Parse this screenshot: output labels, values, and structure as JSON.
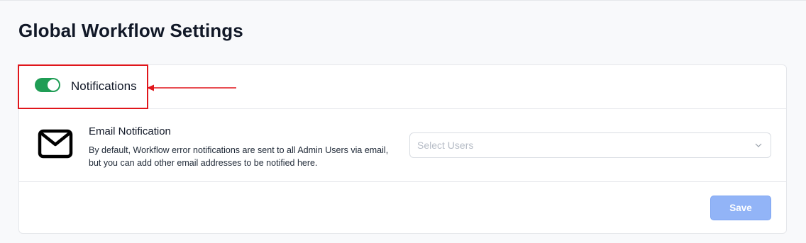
{
  "page": {
    "title": "Global Workflow Settings"
  },
  "notifications": {
    "label": "Notifications",
    "toggle_on": true,
    "toggle_color": "#1f9d55"
  },
  "email_notification": {
    "icon": "mail-icon",
    "title": "Email Notification",
    "description": "By default, Workflow error notifications are sent to all Admin Users via email, but you can add other email addresses to be notified here.",
    "select_placeholder": "Select Users"
  },
  "actions": {
    "save_label": "Save",
    "save_color": "#92b4f7"
  },
  "annotation": {
    "highlight_color": "#e0161b"
  }
}
